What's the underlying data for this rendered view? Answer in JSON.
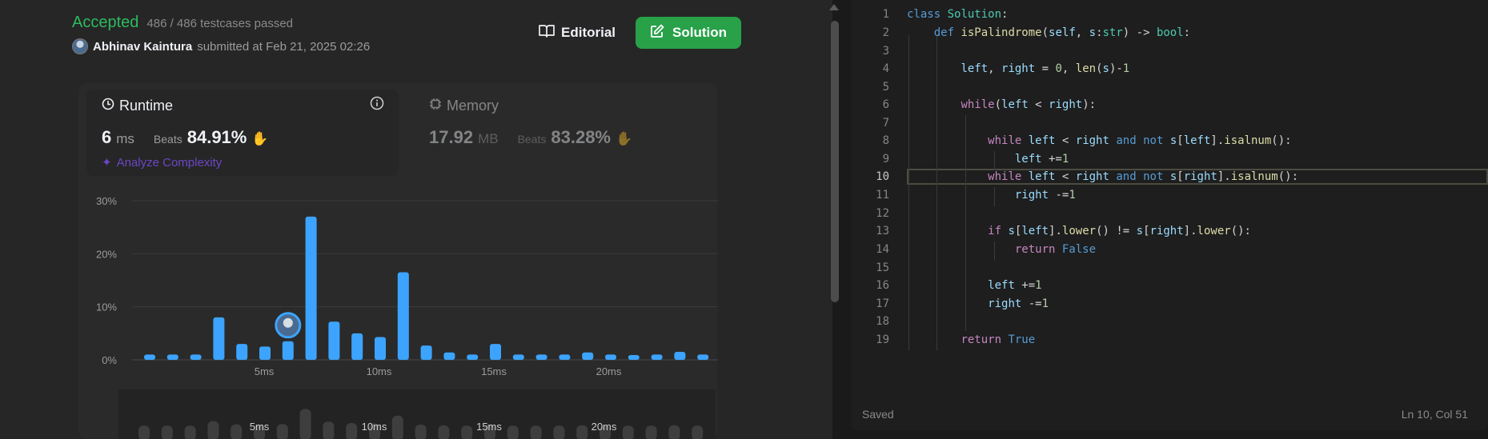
{
  "result": {
    "status": "Accepted",
    "testcases": "486 / 486 testcases passed",
    "user": "Abhinav Kaintura",
    "submitted_text": "submitted at Feb 21, 2025 02:26"
  },
  "buttons": {
    "editorial": "Editorial",
    "solution": "Solution"
  },
  "runtime": {
    "title": "Runtime",
    "value": "6",
    "unit": "ms",
    "beats_label": "Beats",
    "beats": "84.91%"
  },
  "memory": {
    "title": "Memory",
    "value": "17.92",
    "unit": "MB",
    "beats_label": "Beats",
    "beats": "83.28%"
  },
  "analyze_label": "Analyze Complexity",
  "chart_data": {
    "type": "bar",
    "x_ticks": [
      "5ms",
      "10ms",
      "15ms",
      "20ms"
    ],
    "y_ticks": [
      "30%",
      "20%",
      "10%",
      "0%"
    ],
    "ylim": [
      0,
      30
    ],
    "values": [
      1.0,
      1.0,
      1.0,
      8.0,
      3.0,
      2.5,
      3.5,
      27.0,
      7.2,
      5.0,
      4.3,
      16.5,
      2.7,
      1.4,
      1.0,
      3.0,
      1.0,
      1.0,
      1.0,
      1.4,
      1.0,
      0.9,
      1.0,
      1.5,
      1.0
    ],
    "highlight_index": 6,
    "minimap_ticks": [
      "5ms",
      "10ms",
      "15ms",
      "20ms"
    ],
    "bar_color": "#3ca4ff"
  },
  "editor": {
    "line_numbers": [
      "1",
      "2",
      "3",
      "4",
      "5",
      "6",
      "7",
      "8",
      "9",
      "10",
      "11",
      "12",
      "13",
      "14",
      "15",
      "16",
      "17",
      "18",
      "19"
    ],
    "active_line": 10,
    "footer_status": "Saved",
    "cursor_position": "Ln 10, Col 51"
  }
}
